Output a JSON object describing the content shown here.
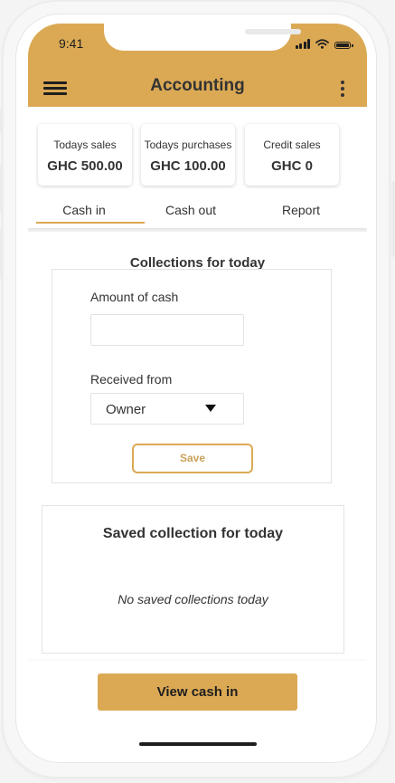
{
  "status_bar": {
    "time": "9:41"
  },
  "header": {
    "title": "Accounting",
    "menu_icon": "hamburger-menu-icon",
    "more_icon": "vertical-dots-icon",
    "accent_color": "#dba954"
  },
  "summary_cards": [
    {
      "label": "Todays sales",
      "value": "GHC 500.00"
    },
    {
      "label": "Todays purchases",
      "value": "GHC 100.00"
    },
    {
      "label": "Credit sales",
      "value": "GHC 0"
    }
  ],
  "tabs": [
    {
      "label": "Cash in",
      "active": true
    },
    {
      "label": "Cash out",
      "active": false
    },
    {
      "label": "Report",
      "active": false
    }
  ],
  "collections": {
    "title": "Collections for today",
    "amount_label": "Amount of cash",
    "amount_value": "",
    "received_from_label": "Received from",
    "received_from_value": "Owner",
    "save_label": "Save"
  },
  "saved": {
    "title": "Saved collection for today",
    "empty_message": "No saved collections today"
  },
  "footer": {
    "view_button_label": "View cash in"
  }
}
